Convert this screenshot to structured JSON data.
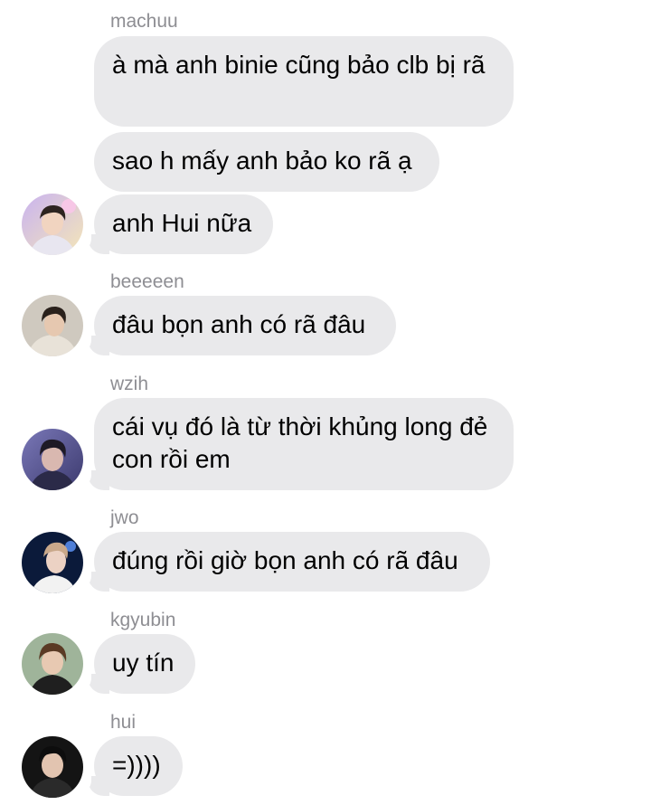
{
  "messages": [
    {
      "sender": "machuu",
      "texts": [
        "à mà anh binie cũng bảo clb bị rã",
        "sao h mấy anh bảo ko rã ạ",
        "anh Hui nữa"
      ]
    },
    {
      "sender": "beeeeen",
      "texts": [
        "đâu bọn anh có rã đâu"
      ]
    },
    {
      "sender": "wzih",
      "texts": [
        "cái vụ đó là từ thời khủng long đẻ con rồi em"
      ]
    },
    {
      "sender": "jwo",
      "texts": [
        "đúng rồi giờ bọn anh có rã đâu"
      ]
    },
    {
      "sender": "kgyubin",
      "texts": [
        "uy tín"
      ]
    },
    {
      "sender": "hui",
      "texts": [
        "=))))"
      ]
    }
  ],
  "colors": {
    "bubble": "#e9e9eb",
    "sender_name": "#8e8e93",
    "background": "#ffffff"
  },
  "icons": [
    "avatar-photo"
  ]
}
